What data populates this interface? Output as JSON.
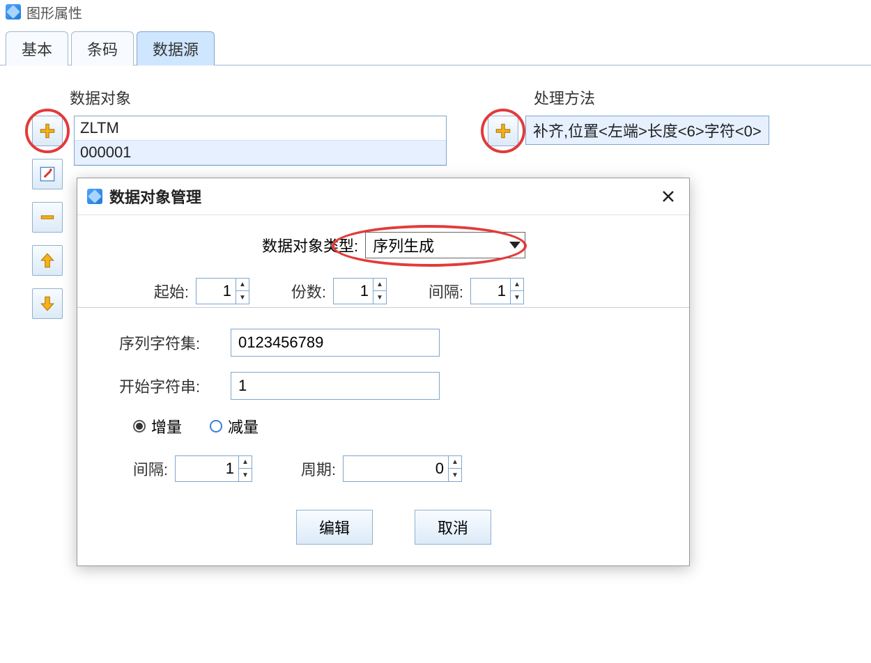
{
  "window": {
    "title": "图形属性"
  },
  "tabs": {
    "basic": "基本",
    "barcode": "条码",
    "datasource": "数据源"
  },
  "dataObject": {
    "groupTitle": "数据对象",
    "items": [
      "ZLTM",
      "000001"
    ]
  },
  "procMethod": {
    "groupTitle": "处理方法",
    "items": [
      "补齐,位置<左端>长度<6>字符<0>"
    ]
  },
  "tool": {
    "add": "add",
    "edit": "edit",
    "remove": "remove",
    "up": "up",
    "down": "down"
  },
  "dialog": {
    "title": "数据对象管理",
    "typeLabel": "数据对象类型:",
    "typeValue": "序列生成",
    "startLabel": "起始:",
    "startValue": "1",
    "copiesLabel": "份数:",
    "copiesValue": "1",
    "intervalLabel": "间隔:",
    "intervalValue": "1",
    "charsetLabel": "序列字符集:",
    "charsetValue": "0123456789",
    "startStrLabel": "开始字符串:",
    "startStrValue": "1",
    "incLabel": "增量",
    "decLabel": "减量",
    "interval2Label": "间隔:",
    "interval2Value": "1",
    "periodLabel": "周期:",
    "periodValue": "0",
    "btnEdit": "编辑",
    "btnCancel": "取消"
  }
}
